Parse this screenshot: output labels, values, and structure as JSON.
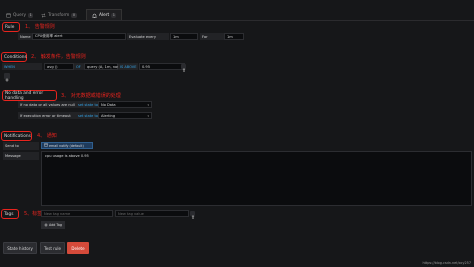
{
  "tabs": [
    {
      "label": "Query",
      "count": "1",
      "icon": "database-icon"
    },
    {
      "label": "Transform",
      "count": "0",
      "icon": "transform-icon"
    },
    {
      "label": "Alert",
      "count": "1",
      "icon": "bell-icon"
    }
  ],
  "rule": {
    "section_label": "Rule",
    "annotation": "1、 告警规则",
    "name_label": "Name",
    "name_value": "CPU使用率 alert",
    "evaluate_label": "Evaluate every",
    "evaluate_value": "1m",
    "for_label": "For",
    "for_value": "1m"
  },
  "conditions": {
    "section_label": "Conditions",
    "annotation": "2、 触发条件，告警规则",
    "when": "WHEN",
    "func": "avg ()",
    "of": "OF",
    "query": "query (A, 1m, now)",
    "comparator": "IS ABOVE",
    "threshold": "0.95"
  },
  "nodata": {
    "section_label": "No data and error handling",
    "annotation": "3、 对无数据或错误的处理",
    "nodata_label": "If no data or all values are null",
    "set_state": "set state to",
    "nodata_value": "No Data",
    "error_label": "If execution error or timeout",
    "error_value": "Alerting"
  },
  "notifications": {
    "section_label": "Notifications",
    "annotation": "4、 通知",
    "send_to_label": "Send to",
    "channel": "email notify (default)",
    "message_label": "Message",
    "message_value": "cpu usage is above 0.95"
  },
  "tags": {
    "section_label": "Tags",
    "annotation": "5、标签",
    "name_placeholder": "New tag name",
    "value_placeholder": "New tag value",
    "add_label": "Add Tag"
  },
  "footer": {
    "state_history": "State history",
    "test_rule": "Test rule",
    "delete": "Delete"
  },
  "watermark": "https://blog.csdn.net/xcy257",
  "colors": {
    "annotation": "#e8241e",
    "keyword": "#33a2e5",
    "danger": "#d44a3a",
    "background": "#161719"
  }
}
